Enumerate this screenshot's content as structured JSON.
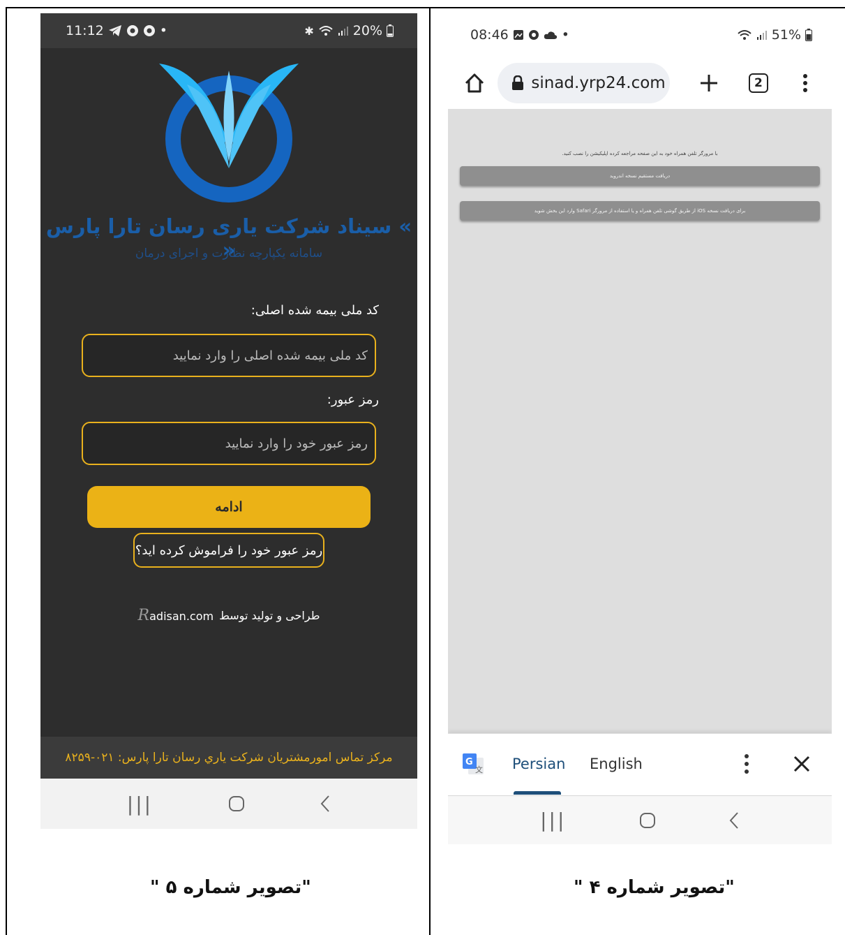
{
  "left_screen": {
    "status_bar": {
      "time": "11:12",
      "battery": "20%"
    },
    "brand": {
      "title": "» سیناد شرکت یاری رسان تارا پارس «",
      "subtitle": "سامانه یکپارچه نظارت و اجرای درمان"
    },
    "form": {
      "national_code_label": "کد ملی بیمه شده اصلی:",
      "national_code_placeholder": "کد ملی بیمه شده اصلی را وارد نمایید",
      "password_label": "رمز عبور:",
      "password_placeholder": "رمز عبور خود را وارد نمایید",
      "continue_label": "ادامه",
      "forgot_label": "رمز عبور خود را فراموش کرده اید؟"
    },
    "credit": {
      "prefix": "طراحی و تولید توسط",
      "brand": "adisan.com"
    },
    "footer": "مرکز تماس امورمشتریان شرکت یاري رسان تارا پارس: ۰۲۱-۸۲۵۹",
    "colors": {
      "background": "#2d2d2d",
      "accent": "#ebb216",
      "brand_blue": "#1a5ea8"
    }
  },
  "right_screen": {
    "status_bar": {
      "time": "08:46",
      "battery": "51%"
    },
    "browser": {
      "url": "sinad.yrp24.com",
      "tab_count": "2"
    },
    "page": {
      "message": "با مرورگر تلفن همراه خود به این صفحه مراجعه کرده اپلیکیشن را نصب کنید.",
      "android_button": "دریافت مستقیم نسخه اندروید",
      "ios_button": "برای دریافت نسخه iOS از طریق گوشی تلفن همراه و یا استفاده از مرورگر Safari وارد این بخش شوید"
    },
    "translate_bar": {
      "lang_from": "Persian",
      "lang_to": "English"
    },
    "colors": {
      "page_bg": "#dedede",
      "button_gray": "#8f8f8f",
      "active_lang": "#1e4f7a"
    }
  },
  "captions": {
    "image5": "\"تصویر شماره ۵ \"",
    "image4": "\"تصویر شماره ۴ \""
  }
}
